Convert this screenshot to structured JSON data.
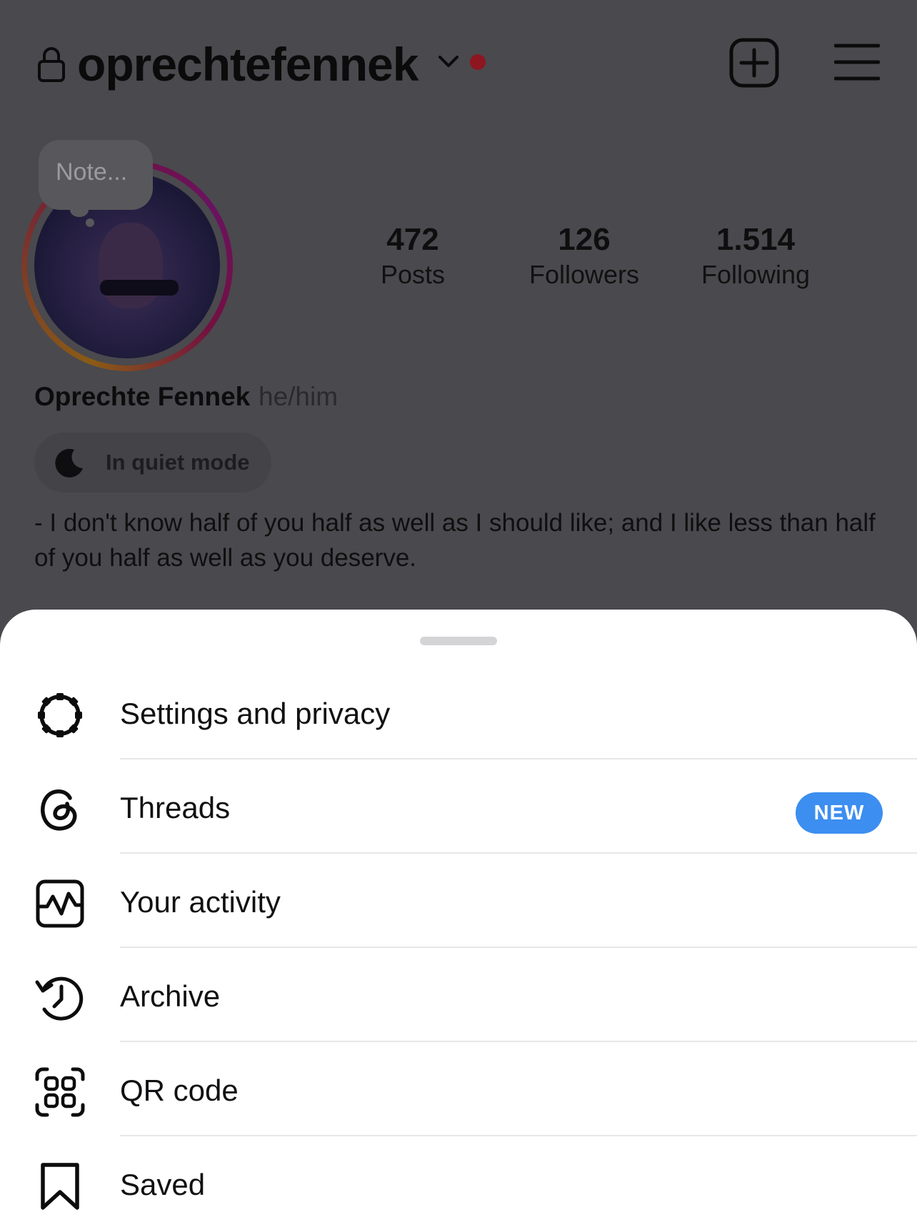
{
  "header": {
    "username": "oprechtefennek",
    "icons": [
      "lock-icon",
      "chevron-down-icon",
      "plus-square-icon",
      "hamburger-menu-icon"
    ],
    "notification_dot_color": "#8e1620"
  },
  "profile": {
    "note_placeholder": "Note...",
    "stats": [
      {
        "value": "472",
        "label": "Posts"
      },
      {
        "value": "126",
        "label": "Followers"
      },
      {
        "value": "1.514",
        "label": "Following"
      }
    ],
    "full_name": "Oprechte Fennek",
    "pronouns": "he/him",
    "quiet_mode": "In quiet mode",
    "bio": "- I don't know half of you half as well as I should like; and I like less than half of you half as well as you deserve."
  },
  "menu": {
    "items": [
      {
        "label": "Settings and privacy",
        "icon": "settings-gear-icon"
      },
      {
        "label": "Threads",
        "icon": "threads-icon",
        "badge": "NEW"
      },
      {
        "label": "Your activity",
        "icon": "activity-icon"
      },
      {
        "label": "Archive",
        "icon": "archive-history-icon"
      },
      {
        "label": "QR code",
        "icon": "qr-code-icon"
      },
      {
        "label": "Saved",
        "icon": "bookmark-icon"
      }
    ],
    "badge_color": "#3c8ef0"
  }
}
